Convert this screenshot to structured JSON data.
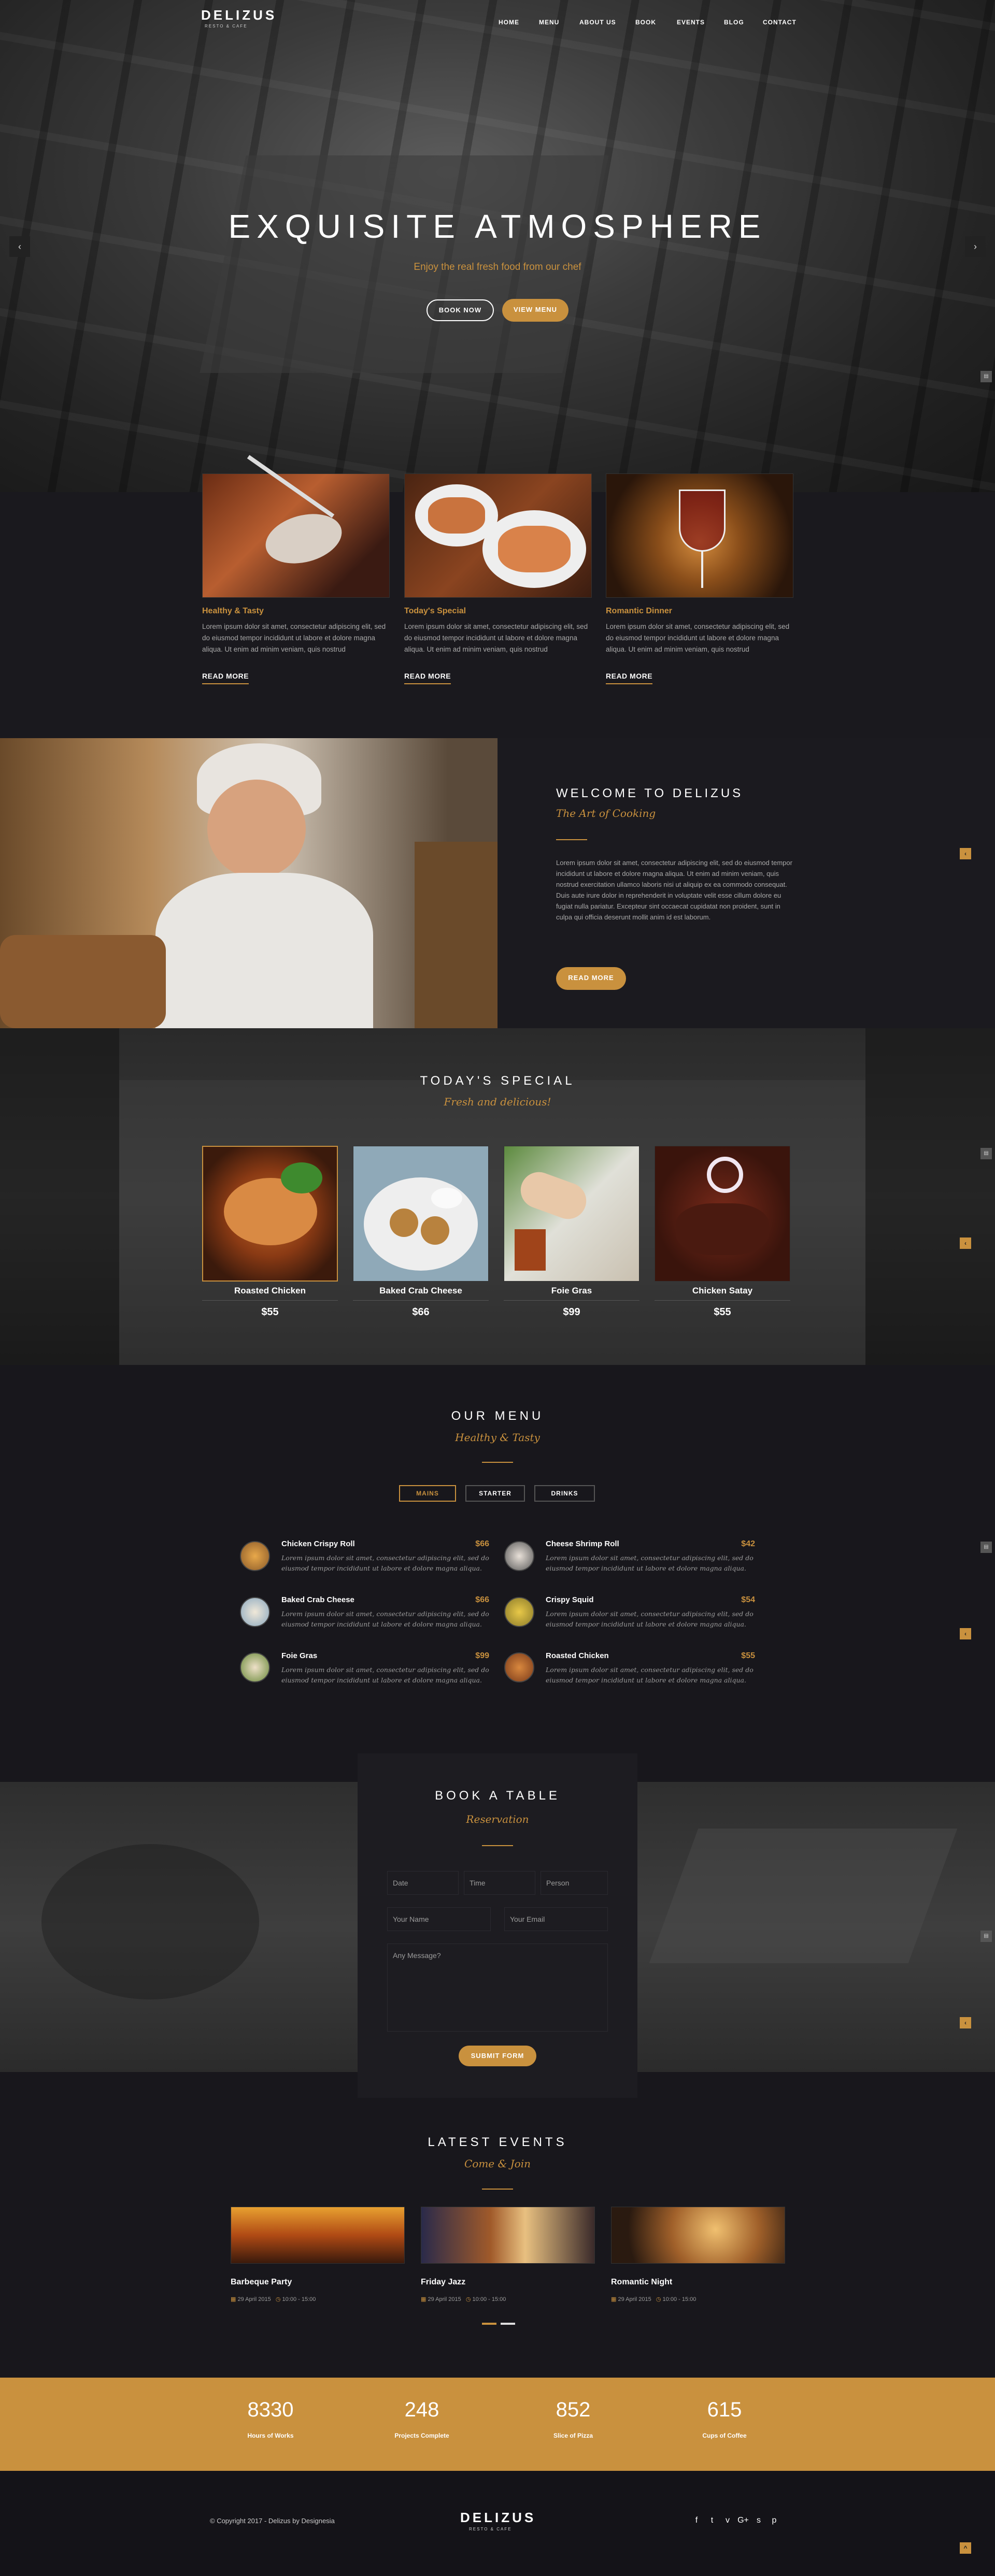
{
  "header": {
    "logo": "DELIZUS",
    "logo_sub": "RESTO & CAFE",
    "nav": [
      "HOME",
      "MENU",
      "ABOUT US",
      "BOOK",
      "EVENTS",
      "BLOG",
      "CONTACT"
    ]
  },
  "hero": {
    "title": "EXQUISITE ATMOSPHERE",
    "subtitle": "Enjoy the real fresh food from our chef",
    "btn_book": "BOOK NOW",
    "btn_menu": "VIEW MENU",
    "prev_icon": "‹",
    "next_icon": "›"
  },
  "features": [
    {
      "title": "Healthy & Tasty",
      "text": "Lorem ipsum dolor sit amet, consectetur adipiscing elit, sed do eiusmod tempor incididunt ut labore et dolore magna aliqua. Ut enim ad minim veniam, quis nostrud",
      "link": "READ MORE"
    },
    {
      "title": "Today's Special",
      "text": "Lorem ipsum dolor sit amet, consectetur adipiscing elit, sed do eiusmod tempor incididunt ut labore et dolore magna aliqua. Ut enim ad minim veniam, quis nostrud",
      "link": "READ MORE"
    },
    {
      "title": "Romantic Dinner",
      "text": "Lorem ipsum dolor sit amet, consectetur adipiscing elit, sed do eiusmod tempor incididunt ut labore et dolore magna aliqua. Ut enim ad minim veniam, quis nostrud",
      "link": "READ MORE"
    }
  ],
  "welcome": {
    "title": "WELCOME TO DELIZUS",
    "script": "The Art of Cooking",
    "text": "Lorem ipsum dolor sit amet, consectetur adipiscing elit, sed do eiusmod tempor incididunt ut labore et dolore magna aliqua. Ut enim ad minim veniam, quis nostrud exercitation ullamco laboris nisi ut aliquip ex ea commodo consequat. Duis aute irure dolor in reprehenderit in voluptate velit esse cillum dolore eu fugiat nulla pariatur. Excepteur sint occaecat cupidatat non proident, sunt in culpa qui officia deserunt mollit anim id est laborum.",
    "button": "READ MORE"
  },
  "special": {
    "title": "TODAY'S SPECIAL",
    "script": "Fresh and delicious!",
    "items": [
      {
        "name": "Roasted Chicken",
        "price": "$55"
      },
      {
        "name": "Baked Crab Cheese",
        "price": "$66"
      },
      {
        "name": "Foie Gras",
        "price": "$99"
      },
      {
        "name": "Chicken Satay",
        "price": "$55"
      }
    ]
  },
  "menu": {
    "title": "OUR MENU",
    "script": "Healthy & Tasty",
    "tabs": [
      "MAINS",
      "STARTER",
      "DRINKS"
    ],
    "desc": "Lorem ipsum dolor sit amet, consectetur adipiscing elit, sed do eiusmod tempor incididunt ut labore et dolore magna aliqua.",
    "items": [
      {
        "name": "Chicken Crispy Roll",
        "price": "$66"
      },
      {
        "name": "Cheese Shrimp Roll",
        "price": "$42"
      },
      {
        "name": "Baked Crab Cheese",
        "price": "$66"
      },
      {
        "name": "Crispy Squid",
        "price": "$54"
      },
      {
        "name": "Foie Gras",
        "price": "$99"
      },
      {
        "name": "Roasted Chicken",
        "price": "$55"
      }
    ]
  },
  "booking": {
    "title": "BOOK A TABLE",
    "script": "Reservation",
    "date": "Date",
    "time": "Time",
    "person": "Person",
    "name": "Your Name",
    "email": "Your Email",
    "message": "Any Message?",
    "submit": "SUBMIT FORM"
  },
  "events": {
    "title": "LATEST EVENTS",
    "script": "Come & Join",
    "items": [
      {
        "title": "Barbeque Party",
        "date": "29 April 2015",
        "time": "10:00 - 15:00"
      },
      {
        "title": "Friday Jazz",
        "date": "29 April 2015",
        "time": "10:00 - 15:00"
      },
      {
        "title": "Romantic Night",
        "date": "29 April 2015",
        "time": "10:00 - 15:00"
      }
    ]
  },
  "counters": [
    {
      "num": "8330",
      "label": "Hours of Works"
    },
    {
      "num": "248",
      "label": "Projects Complete"
    },
    {
      "num": "852",
      "label": "Slice of Pizza"
    },
    {
      "num": "615",
      "label": "Cups of Coffee"
    }
  ],
  "footer": {
    "copyright": "© Copyright 2017 - Delizus by Designesia",
    "logo": "DELIZUS",
    "logo_sub": "RESTO & CAFE",
    "social": [
      "f",
      "t",
      "v",
      "G+",
      "s",
      "p"
    ]
  },
  "colors": {
    "accent": "#c9913e",
    "bg": "#18171c"
  }
}
